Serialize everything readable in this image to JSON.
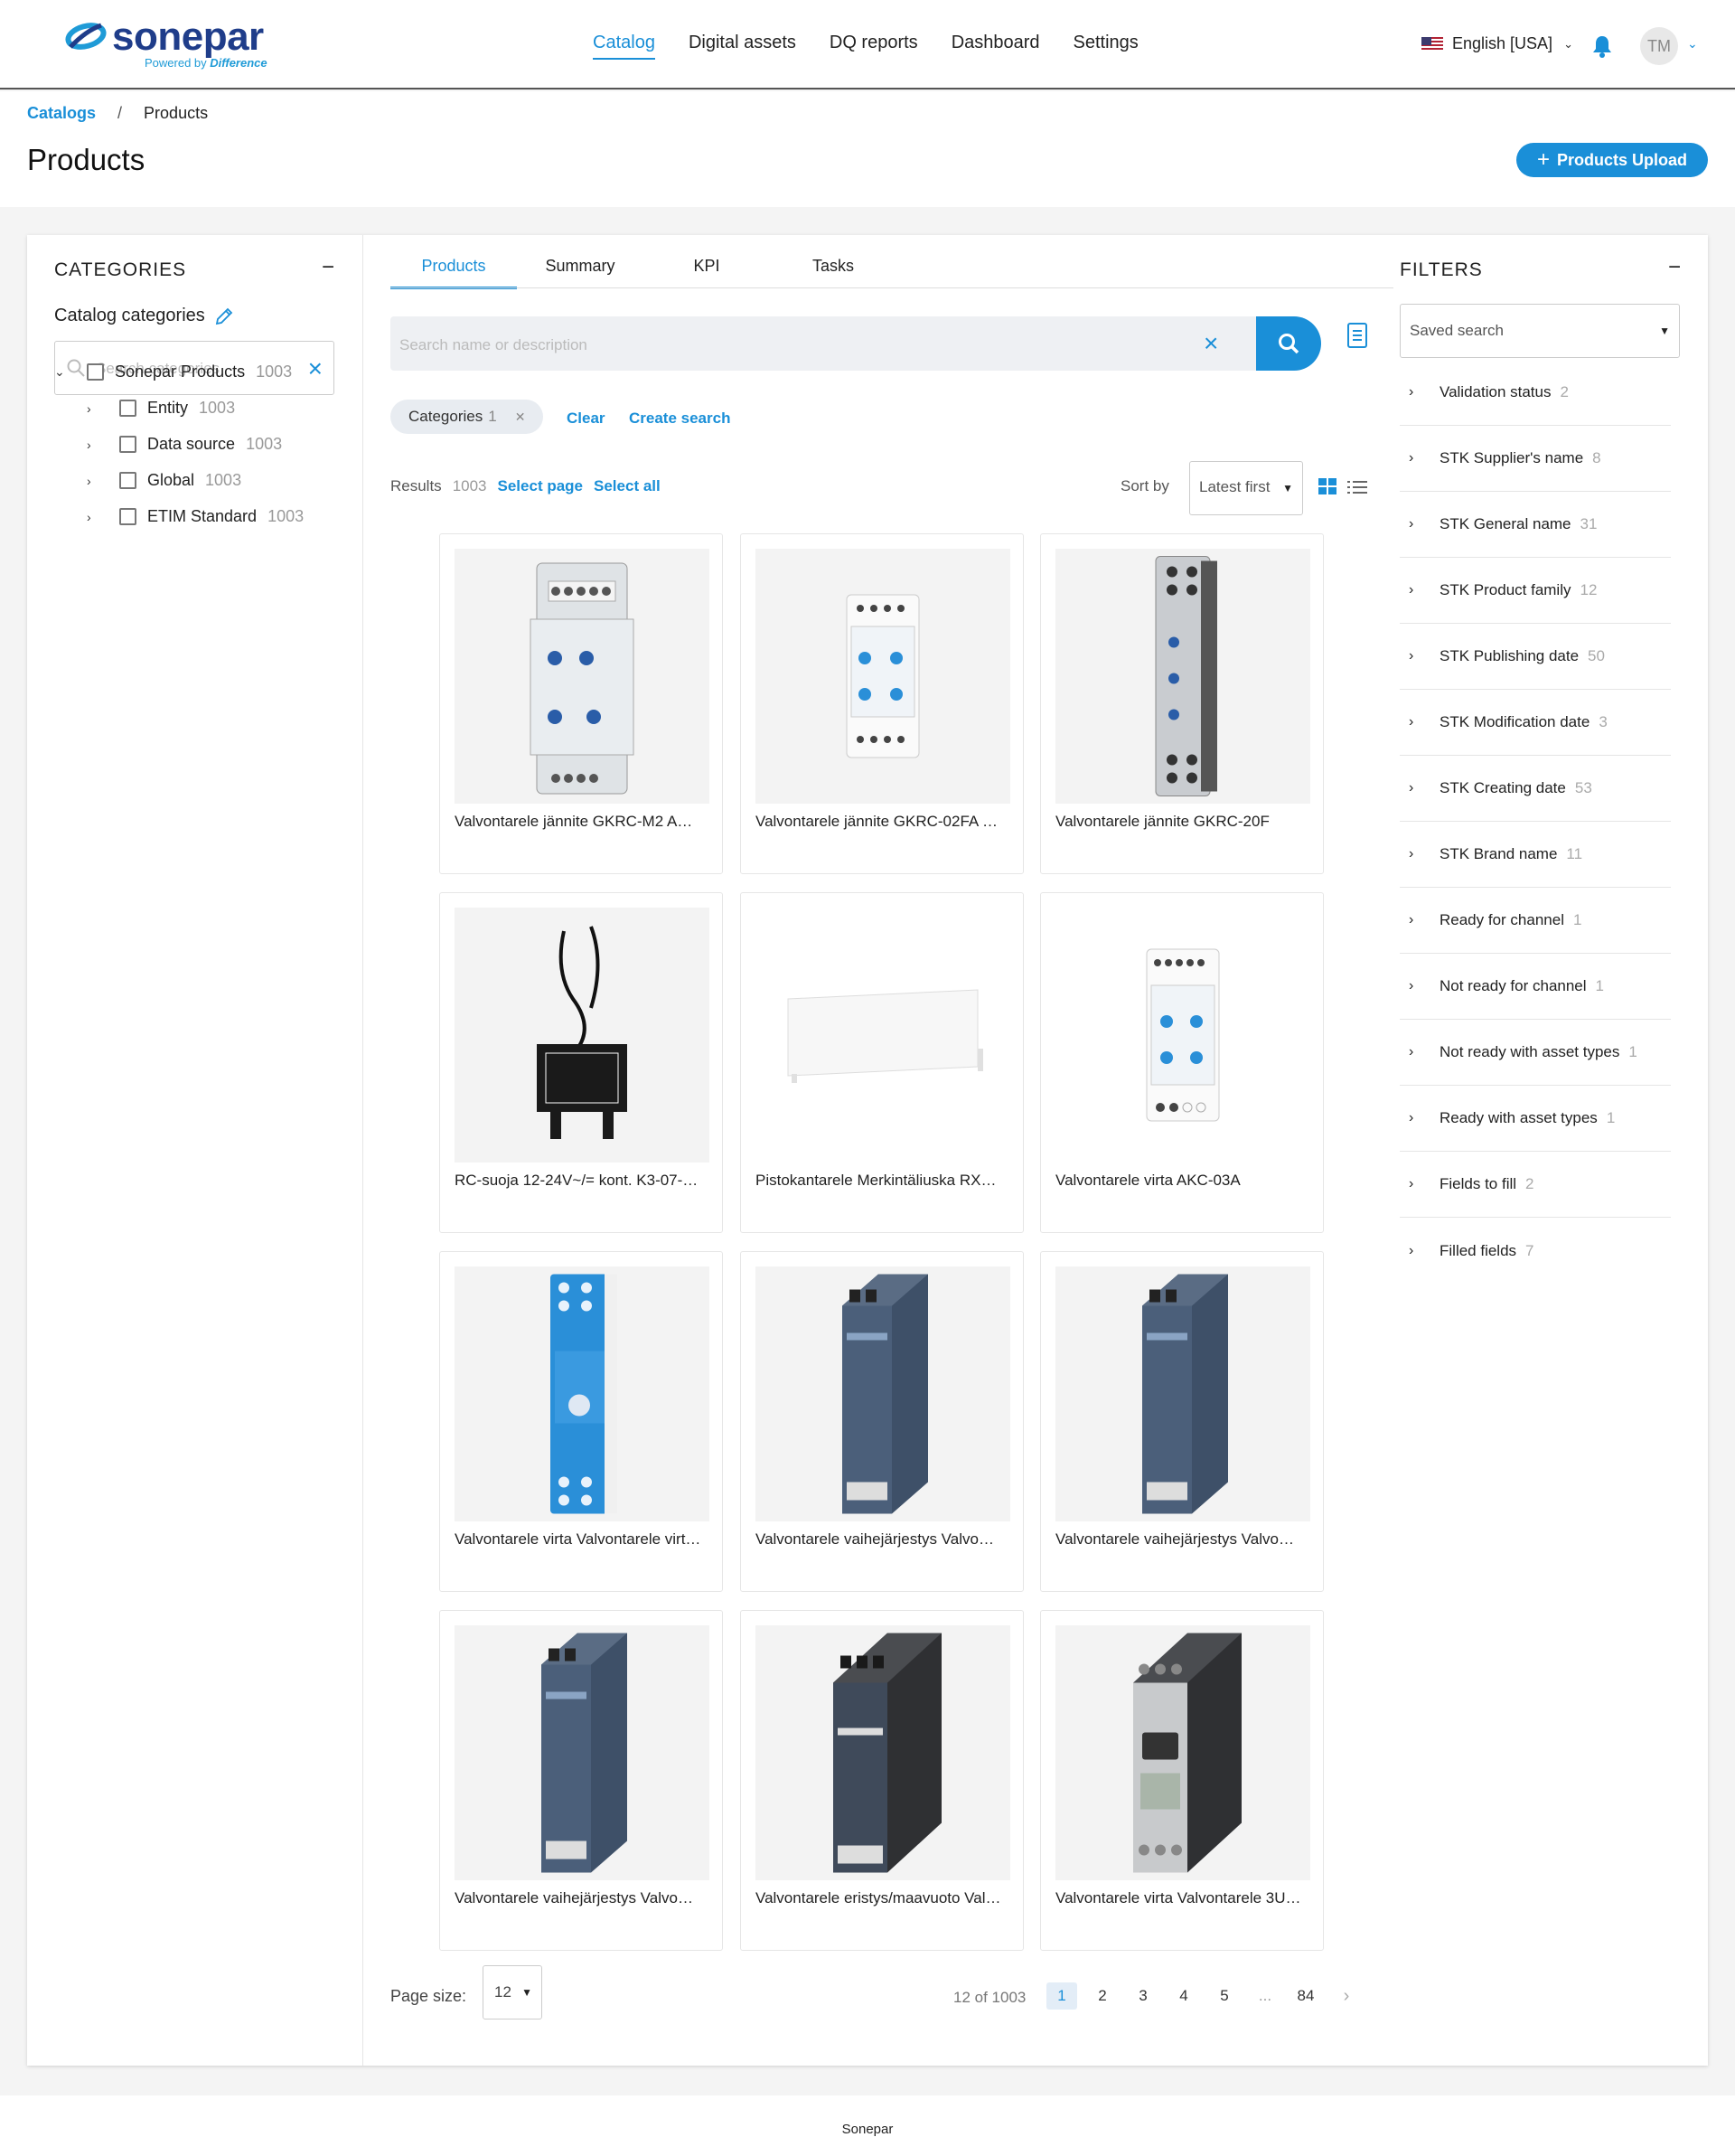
{
  "brand": {
    "name": "sonepar",
    "tagline_prefix": "Powered by",
    "tagline_emph": "Difference"
  },
  "nav": {
    "items": [
      "Catalog",
      "Digital assets",
      "DQ reports",
      "Dashboard",
      "Settings"
    ],
    "active": "Catalog"
  },
  "header": {
    "language": "English [USA]",
    "avatar": "TM"
  },
  "breadcrumb": {
    "root": "Catalogs",
    "separator": "/",
    "current": "Products"
  },
  "page": {
    "title": "Products",
    "upload_label": "Products Upload"
  },
  "categories": {
    "title": "CATEGORIES",
    "collapse": "−",
    "catalog_label": "Catalog categories",
    "search_placeholder": "Search categories",
    "tree": [
      {
        "label": "Sonepar Products",
        "count": "1003",
        "level": 0,
        "expanded": true
      },
      {
        "label": "Entity",
        "count": "1003",
        "level": 1
      },
      {
        "label": "Data source",
        "count": "1003",
        "level": 1
      },
      {
        "label": "Global",
        "count": "1003",
        "level": 1
      },
      {
        "label": "ETIM Standard",
        "count": "1003",
        "level": 1
      }
    ]
  },
  "tabs": [
    "Products",
    "Summary",
    "KPI",
    "Tasks"
  ],
  "search": {
    "placeholder": "Search name or description"
  },
  "chip": {
    "label": "Categories",
    "count": "1"
  },
  "actions": {
    "clear": "Clear",
    "create_search": "Create search"
  },
  "results": {
    "label": "Results",
    "count": "1003",
    "select_page": "Select page",
    "select_all": "Select all"
  },
  "sort": {
    "label": "Sort by",
    "value": "Latest first"
  },
  "products": [
    {
      "name": "Valvontarele jännite GKRC-M2 A…",
      "image": "white-relay-gkrc-m2"
    },
    {
      "name": "Valvontarele jännite GKRC-02FA …",
      "image": "white-relay-gkrc-02fa"
    },
    {
      "name": "Valvontarele jännite GKRC-20F",
      "image": "grey-relay-gkrc-20f"
    },
    {
      "name": "RC-suoja 12-24V~/= kont. K3-07-…",
      "image": "rc-suppressor"
    },
    {
      "name": "Pistokantarele Merkintäliuska RX…",
      "image": "marker-strip"
    },
    {
      "name": "Valvontarele virta AKC-03A",
      "image": "white-relay-akc-03a"
    },
    {
      "name": "Valvontarele virta Valvontarele virt…",
      "image": "blue-relay-eltako"
    },
    {
      "name": "Valvontarele vaihejärjestys Valvo…",
      "image": "siemens-relay-blue"
    },
    {
      "name": "Valvontarele vaihejärjestys Valvo…",
      "image": "siemens-relay-blue"
    },
    {
      "name": "Valvontarele vaihejärjestys Valvo…",
      "image": "siemens-relay-blue"
    },
    {
      "name": "Valvontarele eristys/maavuoto Val…",
      "image": "siemens-relay-dark"
    },
    {
      "name": "Valvontarele virta Valvontarele 3U…",
      "image": "siemens-relay-grey"
    }
  ],
  "pagination": {
    "page_size_label": "Page size:",
    "page_size": "12",
    "info": "12 of 1003",
    "pages": [
      "1",
      "2",
      "3",
      "4",
      "5",
      "...",
      "84"
    ],
    "active": "1",
    "next": "›"
  },
  "filters": {
    "title": "FILTERS",
    "collapse": "−",
    "saved_search": "Saved search",
    "items": [
      {
        "label": "Validation status",
        "count": "2"
      },
      {
        "label": "STK Supplier's name",
        "count": "8"
      },
      {
        "label": "STK General name",
        "count": "31"
      },
      {
        "label": "STK Product family",
        "count": "12"
      },
      {
        "label": "STK Publishing date",
        "count": "50"
      },
      {
        "label": "STK Modification date",
        "count": "3"
      },
      {
        "label": "STK Creating date",
        "count": "53"
      },
      {
        "label": "STK Brand name",
        "count": "11"
      },
      {
        "label": "Ready for channel",
        "count": "1"
      },
      {
        "label": "Not ready for channel",
        "count": "1"
      },
      {
        "label": "Not ready with asset types",
        "count": "1"
      },
      {
        "label": "Ready with asset types",
        "count": "1"
      },
      {
        "label": "Fields to fill",
        "count": "2"
      },
      {
        "label": "Filled fields",
        "count": "7"
      }
    ]
  },
  "footer": {
    "text": "Sonepar"
  },
  "colors": {
    "accent": "#1a8fd8",
    "brand": "#1f3d8a"
  }
}
